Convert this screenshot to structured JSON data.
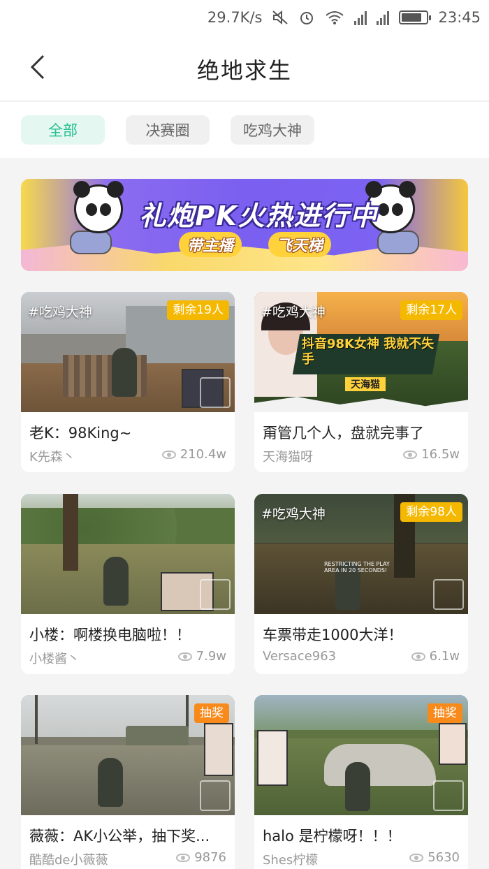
{
  "status_bar": {
    "speed": "29.7K/s",
    "time": "23:45",
    "icons": [
      "mute-icon",
      "alarm-icon",
      "wifi-icon",
      "signal-icon",
      "signal-icon",
      "battery-icon"
    ]
  },
  "header": {
    "title": "绝地求生",
    "back_icon": "chevron-left-icon"
  },
  "tabs": [
    {
      "label": "全部",
      "active": true
    },
    {
      "label": "决赛圈",
      "active": false
    },
    {
      "label": "吃鸡大神",
      "active": false
    }
  ],
  "banner": {
    "title": "礼炮PK火热进行中",
    "sub1": "带主播",
    "sub2": "飞天梯"
  },
  "streams": [
    {
      "title": "老K：98King~",
      "author": "K先森丶",
      "views": "210.4w",
      "hashtag": "#吃鸡大神",
      "badge": "剩余19人",
      "badge_color": "#f5b800"
    },
    {
      "title": "甭管几个人，盘就完事了",
      "author": "天海猫呀",
      "views": "16.5w",
      "hashtag": "#吃鸡大神",
      "badge": "剩余17人",
      "badge_color": "#f5b800",
      "overlay": "抖音98K女神 我就不失手",
      "overlay_sub": "天海猫"
    },
    {
      "title": "小楼：啊楼换电脑啦！！",
      "author": "小楼酱丶",
      "views": "7.9w"
    },
    {
      "title": "车票带走1000大洋！",
      "author": "Versace963",
      "views": "6.1w",
      "hashtag": "#吃鸡大神",
      "badge": "剩余98人",
      "badge_color": "#f5b800"
    },
    {
      "title": "薇薇：AK小公举，抽下奖...",
      "author": "酷酷de小薇薇",
      "views": "9876",
      "badge": "抽奖",
      "badge_color": "#f88a1c"
    },
    {
      "title": "halo 是柠檬呀！！！",
      "author": "Shes柠檬",
      "views": "5630",
      "badge": "抽奖",
      "badge_color": "#f88a1c"
    }
  ]
}
